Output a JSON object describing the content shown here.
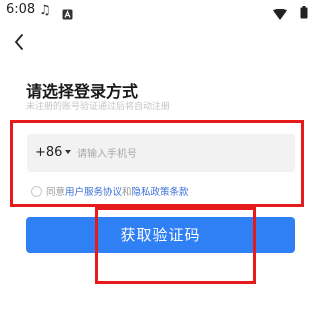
{
  "status_bar": {
    "time": "6:08",
    "icons": [
      "music-note-icon",
      "a-square-icon",
      "wifi-icon",
      "battery-icon"
    ]
  },
  "nav": {
    "back_icon": "chevron-left-icon"
  },
  "header": {
    "title": "请选择登录方式",
    "subtitle": "未注册的账号验证通过后将自动注册"
  },
  "phone": {
    "country_code": "+86",
    "placeholder": "请输入手机号",
    "value": ""
  },
  "agreement": {
    "prefix": "同意",
    "user_agreement": "用户服务协议",
    "conjunction": "和",
    "privacy_policy": "隐私政策条款",
    "checked": false
  },
  "actions": {
    "get_code_label": "获取验证码"
  },
  "colors": {
    "primary": "#2f7ff5",
    "link": "#3a6fd8",
    "highlight": "#e61a1a"
  }
}
